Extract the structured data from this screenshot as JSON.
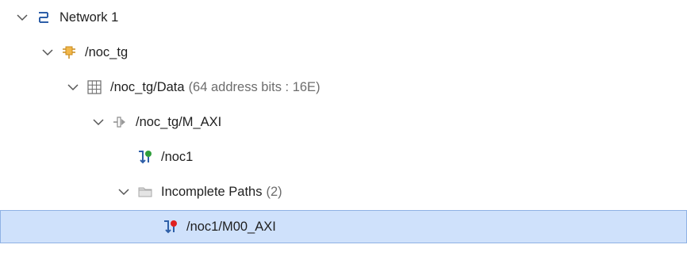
{
  "tree": {
    "network": {
      "label": "Network 1"
    },
    "noc_tg": {
      "label": "/noc_tg"
    },
    "data": {
      "label": "/noc_tg/Data",
      "info": "(64 address bits : 16E)"
    },
    "m_axi": {
      "label": "/noc_tg/M_AXI"
    },
    "noc1": {
      "label": "/noc1"
    },
    "incomplete_paths": {
      "label": "Incomplete Paths",
      "count": "(2)"
    },
    "noc1_m00_axi": {
      "label": "/noc1/M00_AXI"
    }
  },
  "colors": {
    "selection_bg": "#cfe1fb",
    "selection_border": "#8fb2e4",
    "connected_dot": "#2f9e3b",
    "error_dot": "#e02020",
    "tree_icon_blue": "#2e5fa8"
  }
}
